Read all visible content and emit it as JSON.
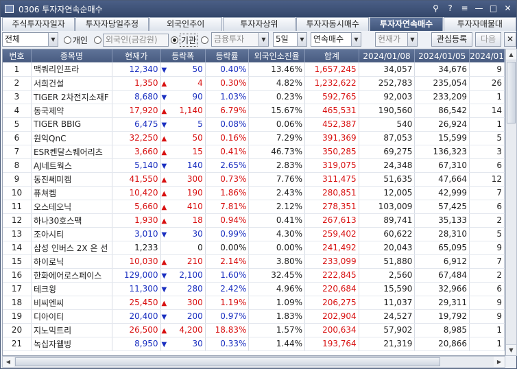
{
  "window": {
    "title": "0306 투자자연속순매수",
    "buttons": [
      "⚲",
      "?",
      "≡",
      "—",
      "□",
      "✕"
    ]
  },
  "tabs": [
    {
      "label": "주식투자자일자",
      "active": false
    },
    {
      "label": "투자자당일추정",
      "active": false
    },
    {
      "label": "외국인추이",
      "active": false
    },
    {
      "label": "투자자상위",
      "active": false
    },
    {
      "label": "투자자동시매수",
      "active": false
    },
    {
      "label": "투자자연속매수",
      "active": true
    },
    {
      "label": "투자자매물대",
      "active": false
    }
  ],
  "toolbar": {
    "market_select": "전체",
    "radio_individual": "개인",
    "radio_foreign": "외국인(금감원)",
    "radio_institution": "기관",
    "institution_type_select": "금융투자",
    "days_select": "5일",
    "trade_type_select": "연속매수",
    "price_select": "현재가",
    "register_button": "관심등록",
    "next_button": "다음",
    "close_glyph": "✕"
  },
  "colors": {
    "up": "#d81010",
    "down": "#1a2fc0",
    "header_bg": "#485b80",
    "active_tab": "#3f5479"
  },
  "table": {
    "columns": [
      "번호",
      "종목명",
      "현재가",
      "등락폭",
      "등락률",
      "외국인소진율",
      "합계",
      "2024/01/08",
      "2024/01/05",
      "2024/01"
    ],
    "rows": [
      {
        "no": "1",
        "name": "맥쿼리인프라",
        "price": "12,340",
        "dir": "down",
        "change": "50",
        "rate": "0.40%",
        "foreign": "13.46%",
        "total": "1,657,245",
        "d1": "34,057",
        "d2": "34,676",
        "d3": "9"
      },
      {
        "no": "2",
        "name": "서희건설",
        "price": "1,350",
        "dir": "up",
        "change": "4",
        "rate": "0.30%",
        "foreign": "4.82%",
        "total": "1,232,622",
        "d1": "252,783",
        "d2": "235,054",
        "d3": "26"
      },
      {
        "no": "3",
        "name": "TIGER 2차전지소재F",
        "price": "8,680",
        "dir": "down",
        "change": "90",
        "rate": "1.03%",
        "foreign": "0.23%",
        "total": "592,765",
        "d1": "92,003",
        "d2": "233,209",
        "d3": "1"
      },
      {
        "no": "4",
        "name": "동국제약",
        "price": "17,920",
        "dir": "up",
        "change": "1,140",
        "rate": "6.79%",
        "foreign": "15.67%",
        "total": "465,531",
        "d1": "190,560",
        "d2": "86,542",
        "d3": "14"
      },
      {
        "no": "5",
        "name": "TIGER BBIG",
        "price": "6,475",
        "dir": "down",
        "change": "5",
        "rate": "0.08%",
        "foreign": "0.06%",
        "total": "452,387",
        "d1": "540",
        "d2": "26,924",
        "d3": "1"
      },
      {
        "no": "6",
        "name": "원익QnC",
        "price": "32,250",
        "dir": "up",
        "change": "50",
        "rate": "0.16%",
        "foreign": "7.29%",
        "total": "391,369",
        "d1": "87,053",
        "d2": "15,599",
        "d3": "5"
      },
      {
        "no": "7",
        "name": "ESR켄달스퀘어리츠",
        "price": "3,660",
        "dir": "up",
        "change": "15",
        "rate": "0.41%",
        "foreign": "46.73%",
        "total": "350,285",
        "d1": "69,275",
        "d2": "136,323",
        "d3": "3"
      },
      {
        "no": "8",
        "name": "AJ네트웍스",
        "price": "5,140",
        "dir": "down",
        "change": "140",
        "rate": "2.65%",
        "foreign": "2.83%",
        "total": "319,075",
        "d1": "24,348",
        "d2": "67,310",
        "d3": "6"
      },
      {
        "no": "9",
        "name": "동진쎄미켐",
        "price": "41,550",
        "dir": "up",
        "change": "300",
        "rate": "0.73%",
        "foreign": "7.76%",
        "total": "311,475",
        "d1": "51,635",
        "d2": "47,664",
        "d3": "12"
      },
      {
        "no": "10",
        "name": "퓨쳐켐",
        "price": "10,420",
        "dir": "up",
        "change": "190",
        "rate": "1.86%",
        "foreign": "2.43%",
        "total": "280,851",
        "d1": "12,005",
        "d2": "42,999",
        "d3": "7"
      },
      {
        "no": "11",
        "name": "오스테오닉",
        "price": "5,660",
        "dir": "up",
        "change": "410",
        "rate": "7.81%",
        "foreign": "2.12%",
        "total": "278,351",
        "d1": "103,009",
        "d2": "57,425",
        "d3": "6"
      },
      {
        "no": "12",
        "name": "하나30호스팩",
        "price": "1,930",
        "dir": "up",
        "change": "18",
        "rate": "0.94%",
        "foreign": "0.41%",
        "total": "267,613",
        "d1": "89,741",
        "d2": "35,133",
        "d3": "2"
      },
      {
        "no": "13",
        "name": "조아시티",
        "price": "3,010",
        "dir": "down",
        "change": "30",
        "rate": "0.99%",
        "foreign": "4.30%",
        "total": "259,402",
        "d1": "60,622",
        "d2": "28,310",
        "d3": "5"
      },
      {
        "no": "14",
        "name": "삼성 인버스 2X 은 선",
        "price": "1,233",
        "dir": "flat",
        "change": "0",
        "rate": "0.00%",
        "foreign": "0.00%",
        "total": "241,492",
        "d1": "20,043",
        "d2": "65,095",
        "d3": "9"
      },
      {
        "no": "15",
        "name": "하이로닉",
        "price": "10,030",
        "dir": "up",
        "change": "210",
        "rate": "2.14%",
        "foreign": "3.80%",
        "total": "233,099",
        "d1": "51,880",
        "d2": "6,912",
        "d3": "7"
      },
      {
        "no": "16",
        "name": "한화에어로스페이스",
        "price": "129,000",
        "dir": "down",
        "change": "2,100",
        "rate": "1.60%",
        "foreign": "32.45%",
        "total": "222,845",
        "d1": "2,560",
        "d2": "67,484",
        "d3": "2"
      },
      {
        "no": "17",
        "name": "테크윙",
        "price": "11,300",
        "dir": "down",
        "change": "280",
        "rate": "2.42%",
        "foreign": "4.96%",
        "total": "220,684",
        "d1": "15,590",
        "d2": "32,966",
        "d3": "6"
      },
      {
        "no": "18",
        "name": "비씨엔씨",
        "price": "25,450",
        "dir": "up",
        "change": "300",
        "rate": "1.19%",
        "foreign": "1.09%",
        "total": "206,275",
        "d1": "11,037",
        "d2": "29,311",
        "d3": "9"
      },
      {
        "no": "19",
        "name": "디아이티",
        "price": "20,400",
        "dir": "down",
        "change": "200",
        "rate": "0.97%",
        "foreign": "1.83%",
        "total": "202,904",
        "d1": "24,527",
        "d2": "19,792",
        "d3": "9"
      },
      {
        "no": "20",
        "name": "지노믹트리",
        "price": "26,500",
        "dir": "up",
        "change": "4,200",
        "rate": "18.83%",
        "foreign": "1.57%",
        "total": "200,634",
        "d1": "57,902",
        "d2": "8,985",
        "d3": "1"
      },
      {
        "no": "21",
        "name": "녹십자웰빙",
        "price": "8,950",
        "dir": "down",
        "change": "30",
        "rate": "0.33%",
        "foreign": "1.44%",
        "total": "193,764",
        "d1": "21,319",
        "d2": "20,866",
        "d3": "1"
      }
    ]
  }
}
